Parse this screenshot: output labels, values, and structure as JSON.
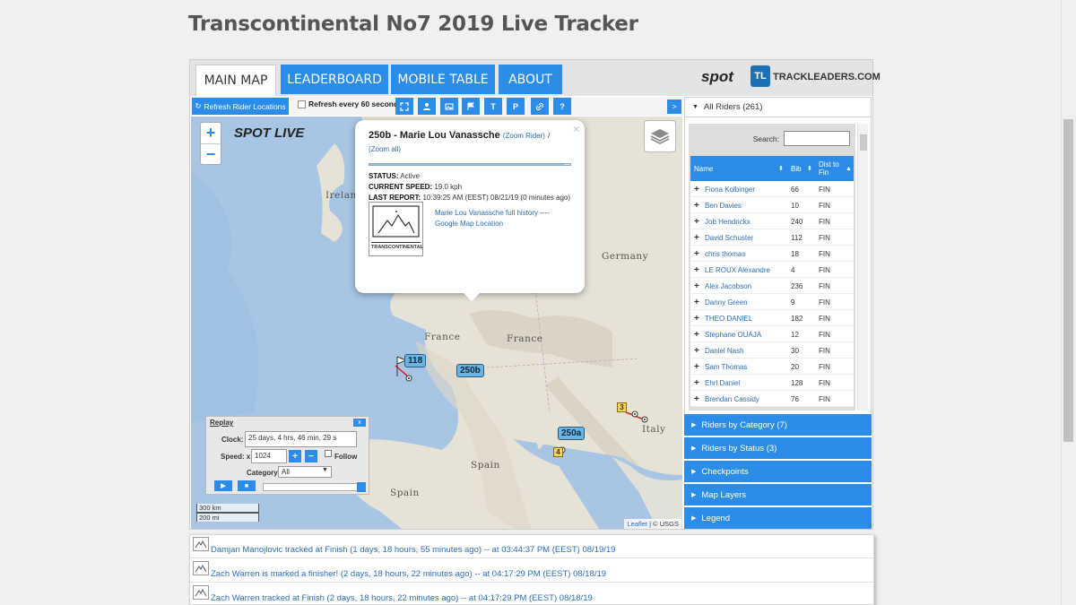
{
  "page": {
    "title": "Transcontinental No7 2019 Live Tracker"
  },
  "tabs": [
    {
      "label": "MAIN MAP",
      "active": true
    },
    {
      "label": "LEADERBOARD",
      "active": false
    },
    {
      "label": "MOBILE TABLE",
      "active": false
    },
    {
      "label": "ABOUT",
      "active": false
    }
  ],
  "brand": {
    "spot": "spot",
    "trackleaders": "TRACKLEADERS.COM",
    "tl_badge": "TL"
  },
  "toolbar": {
    "refresh_label": "Refresh Rider Locations",
    "auto_refresh_label": "Refresh every 60 seconds",
    "buttons": [
      "expand-icon",
      "person-icon",
      "image-icon",
      "flag-icon",
      "T",
      "P",
      "link-icon",
      "?"
    ],
    "collapse": ">"
  },
  "map": {
    "zoom_in": "+",
    "zoom_out": "−",
    "spot_live": "SPOT LIVE",
    "labels": {
      "ireland": "Irelan",
      "germany": "Germany",
      "france1": "France",
      "france2": "France",
      "italy": "Italy",
      "spain1": "Spain",
      "spain2": "Spain"
    },
    "markers": {
      "m118": "118",
      "m250b": "250b",
      "m250a": "250a"
    },
    "checkpoints": {
      "c3": "3",
      "c4": "4"
    },
    "scale_km": "300 km",
    "scale_mi": "200 mi",
    "attribution_link": "Leaflet",
    "attribution_text": " | © USGS"
  },
  "popup": {
    "name": "250b - Marie Lou Vanassche",
    "zoom_rider": "(Zoom Rider)",
    "sep": "/",
    "zoom_all": "(Zoom all)",
    "progress": 0.97,
    "status_label": "STATUS:",
    "status_value": "Active",
    "speed_label": "CURRENT SPEED:",
    "speed_value": "19.0 kph",
    "report_label": "LAST REPORT:",
    "report_value": "10:39:25 AM (EEST) 08/21/19 (0 minutes ago)",
    "history_link": "Marie Lou Vanassche full history",
    "dashes": "----",
    "gmap_link": "Google Map Location",
    "logo_text": "TRANSCONTINENTAL",
    "close": "×"
  },
  "replay": {
    "title": "Replay",
    "close": "x",
    "clock_label": "Clock:",
    "clock_value": "25 days, 4 hrs, 46 min, 29 s",
    "speed_label": "Speed: x",
    "speed_value": "1024",
    "follow_label": "Follow",
    "category_label": "Category:",
    "category_value": "All",
    "play": "▶",
    "stop": "■",
    "plus": "+",
    "minus": "−"
  },
  "sidebar": {
    "all_riders": "All Riders (261)",
    "search_label": "Search:",
    "columns": {
      "name": "Name",
      "bib": "Bib",
      "dist": "Dist to Fin"
    },
    "riders": [
      {
        "name": "Fiona Kolbinger",
        "bib": "66",
        "dist": "FIN"
      },
      {
        "name": "Ben Davies",
        "bib": "10",
        "dist": "FIN"
      },
      {
        "name": "Job Hendrickx",
        "bib": "240",
        "dist": "FIN"
      },
      {
        "name": "David Schuster",
        "bib": "112",
        "dist": "FIN"
      },
      {
        "name": "chris thomas",
        "bib": "18",
        "dist": "FIN"
      },
      {
        "name": "LE ROUX Alexandre",
        "bib": "4",
        "dist": "FIN"
      },
      {
        "name": "Alex Jacobson",
        "bib": "236",
        "dist": "FIN"
      },
      {
        "name": "Danny Green",
        "bib": "9",
        "dist": "FIN"
      },
      {
        "name": "THEO DANIEL",
        "bib": "182",
        "dist": "FIN"
      },
      {
        "name": "Stephane OUAJA",
        "bib": "12",
        "dist": "FIN"
      },
      {
        "name": "Daniel Nash",
        "bib": "30",
        "dist": "FIN"
      },
      {
        "name": "Sam Thomas",
        "bib": "20",
        "dist": "FIN"
      },
      {
        "name": "Ehrl Daniel",
        "bib": "128",
        "dist": "FIN"
      },
      {
        "name": "Brendan Cassidy",
        "bib": "76",
        "dist": "FIN"
      }
    ],
    "sections": [
      "Riders by Category (7)",
      "Riders by Status (3)",
      "Checkpoints",
      "Map Layers",
      "Legend"
    ]
  },
  "feed": [
    "Damjan Manojlovic tracked at Finish (1 days, 18 hours, 55 minutes ago) -- at 03:44:37 PM (EEST) 08/19/19",
    "Zach Warren is marked a finisher! (2 days, 18 hours, 22 minutes ago) -- at 04:17:29 PM (EEST) 08/18/19",
    "Zach Warren tracked at Finish (2 days, 18 hours, 22 minutes ago) -- at 04:17:29 PM (EEST) 08/18/19"
  ]
}
